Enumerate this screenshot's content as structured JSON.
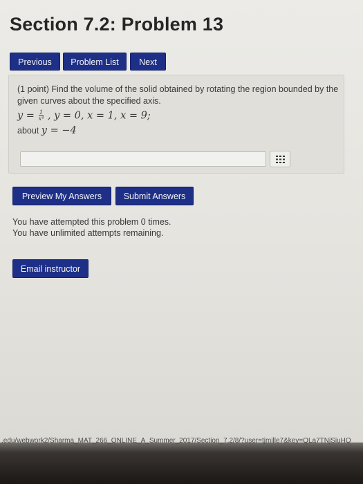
{
  "page": {
    "title": "Section 7.2: Problem 13"
  },
  "nav": {
    "previous": "Previous",
    "problem_list": "Problem List",
    "next": "Next"
  },
  "problem": {
    "points": "(1 point)",
    "statement": "Find the volume of the solid obtained by rotating the region bounded by the given curves about the specified axis.",
    "eq_y": "y =",
    "frac_num": "1",
    "frac_den": "x⁴",
    "eq_rest": ",  y = 0,  x = 1,  x = 9;",
    "about_label": "about",
    "about_eq": "y = −4"
  },
  "answer": {
    "value": "",
    "equation_editor_icon": "grid-icon"
  },
  "actions": {
    "preview": "Preview My Answers",
    "submit": "Submit Answers"
  },
  "attempts": {
    "line1": "You have attempted this problem 0 times.",
    "line2": "You have unlimited attempts remaining."
  },
  "email": {
    "label": "Email instructor"
  },
  "status": {
    "url": ".edu/webwork2/Sharma_MAT_266_ONLINE_A_Summer_2017/Section_7.2/8/?user=tjmille7&key=QLa7TNjSiuHO"
  },
  "colors": {
    "button_bg": "#1d2f86",
    "panel_bg": "#e1dfda"
  }
}
